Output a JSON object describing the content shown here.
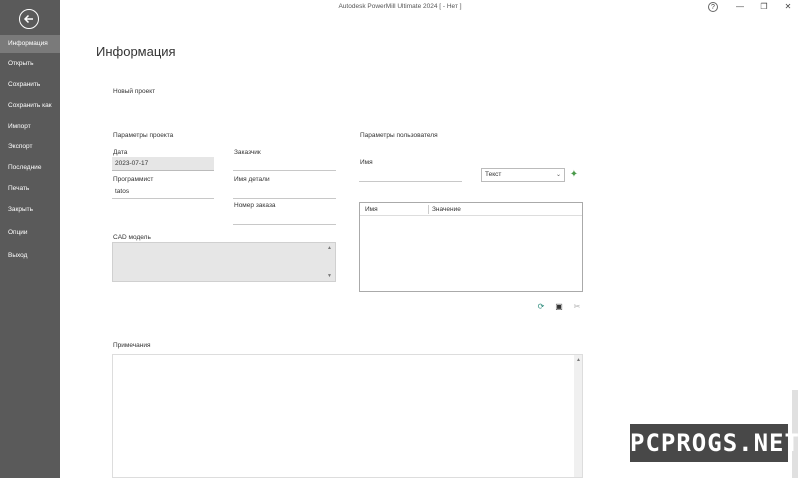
{
  "window": {
    "title": "Autodesk PowerMill Ultimate 2024   [ - Нет ]",
    "help_glyph": "?",
    "minimize_glyph": "—",
    "restore_glyph": "❐",
    "close_glyph": "✕"
  },
  "sidebar": {
    "items": [
      {
        "label": "Информация",
        "active": true
      },
      {
        "label": "Открыть"
      },
      {
        "label": "Сохранить"
      },
      {
        "label": "Сохранить как"
      },
      {
        "label": "Импорт"
      },
      {
        "label": "Экспорт"
      },
      {
        "label": "Последние"
      },
      {
        "label": "Печать"
      },
      {
        "label": "Закрыть"
      },
      {
        "label": "Опции"
      },
      {
        "label": "Выход"
      }
    ]
  },
  "main": {
    "page_title": "Информация",
    "project_name": "Новый проект",
    "project_params": {
      "section_label": "Параметры проекта",
      "date_label": "Дата",
      "date_value": "2023-07-17",
      "programmer_label": "Программист",
      "programmer_value": "tatos",
      "customer_label": "Заказчик",
      "customer_value": "",
      "part_name_label": "Имя детали",
      "part_name_value": "",
      "order_number_label": "Номер заказа",
      "order_number_value": "",
      "cad_model_label": "CAD модель"
    },
    "user_params": {
      "section_label": "Параметры пользователя",
      "name_label": "Имя",
      "name_value": "",
      "type_select_value": "Текст",
      "table_headers": [
        "Имя",
        "Значение"
      ]
    },
    "notes_label": "Примечания"
  },
  "watermark": "PCPROGS.NET"
}
